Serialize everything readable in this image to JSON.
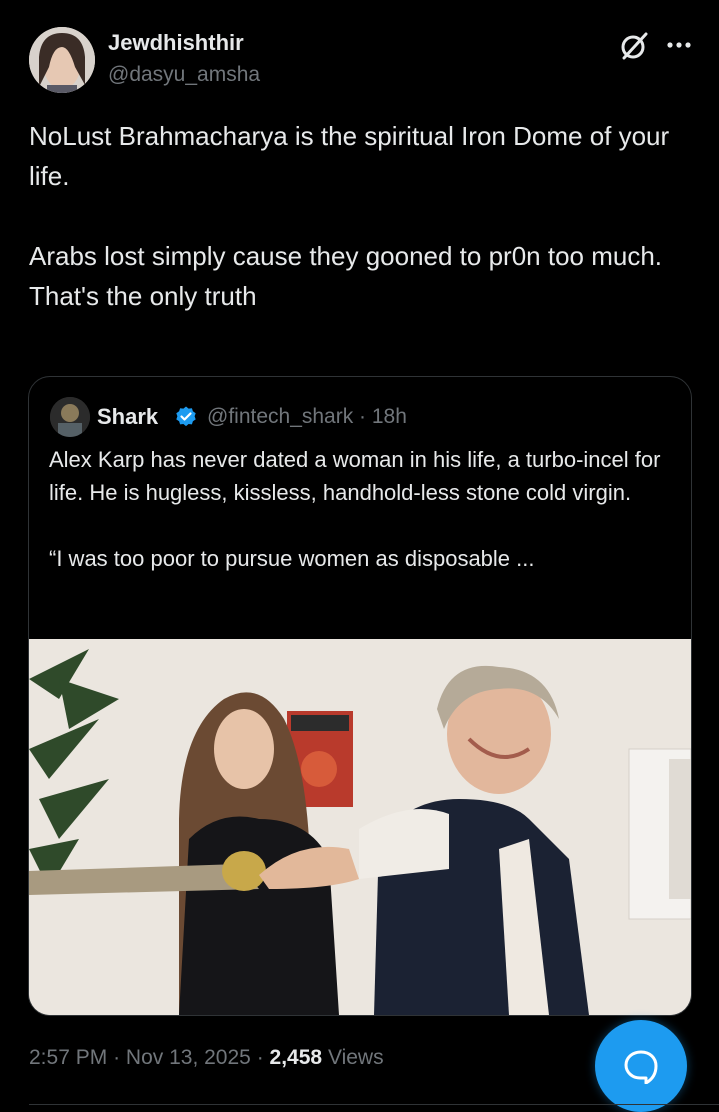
{
  "author": {
    "display_name": "Jewdhishthir",
    "handle": "@dasyu_amsha"
  },
  "tweet": {
    "paragraphs": [
      "NoLust Brahmacharya is the spiritual Iron Dome of your life.",
      "Arabs lost simply cause they gooned to pr0n too much.\nThat's the only truth"
    ],
    "time": "2:57 PM",
    "date": "Nov 13, 2025",
    "separator": "·",
    "views_count": "2,458",
    "views_label": "Views"
  },
  "quote": {
    "display_name": "Shark",
    "handle_line": "@fintech_shark · 18h",
    "paragraphs": [
      "Alex Karp has never dated a woman in his life, a turbo-incel for life. He is hugless, kissless, handhold-less stone cold virgin.",
      "“I was too poor to pursue women as disposable ..."
    ]
  },
  "icons": {
    "grok": "grok-icon",
    "more": "more-icon",
    "verified": "verified-badge-icon",
    "reply": "reply-bubble-icon"
  },
  "colors": {
    "background": "#000000",
    "text_primary": "#e7e9ea",
    "text_secondary": "#71767b",
    "accent": "#1d9bf0",
    "border": "#2f3336"
  }
}
